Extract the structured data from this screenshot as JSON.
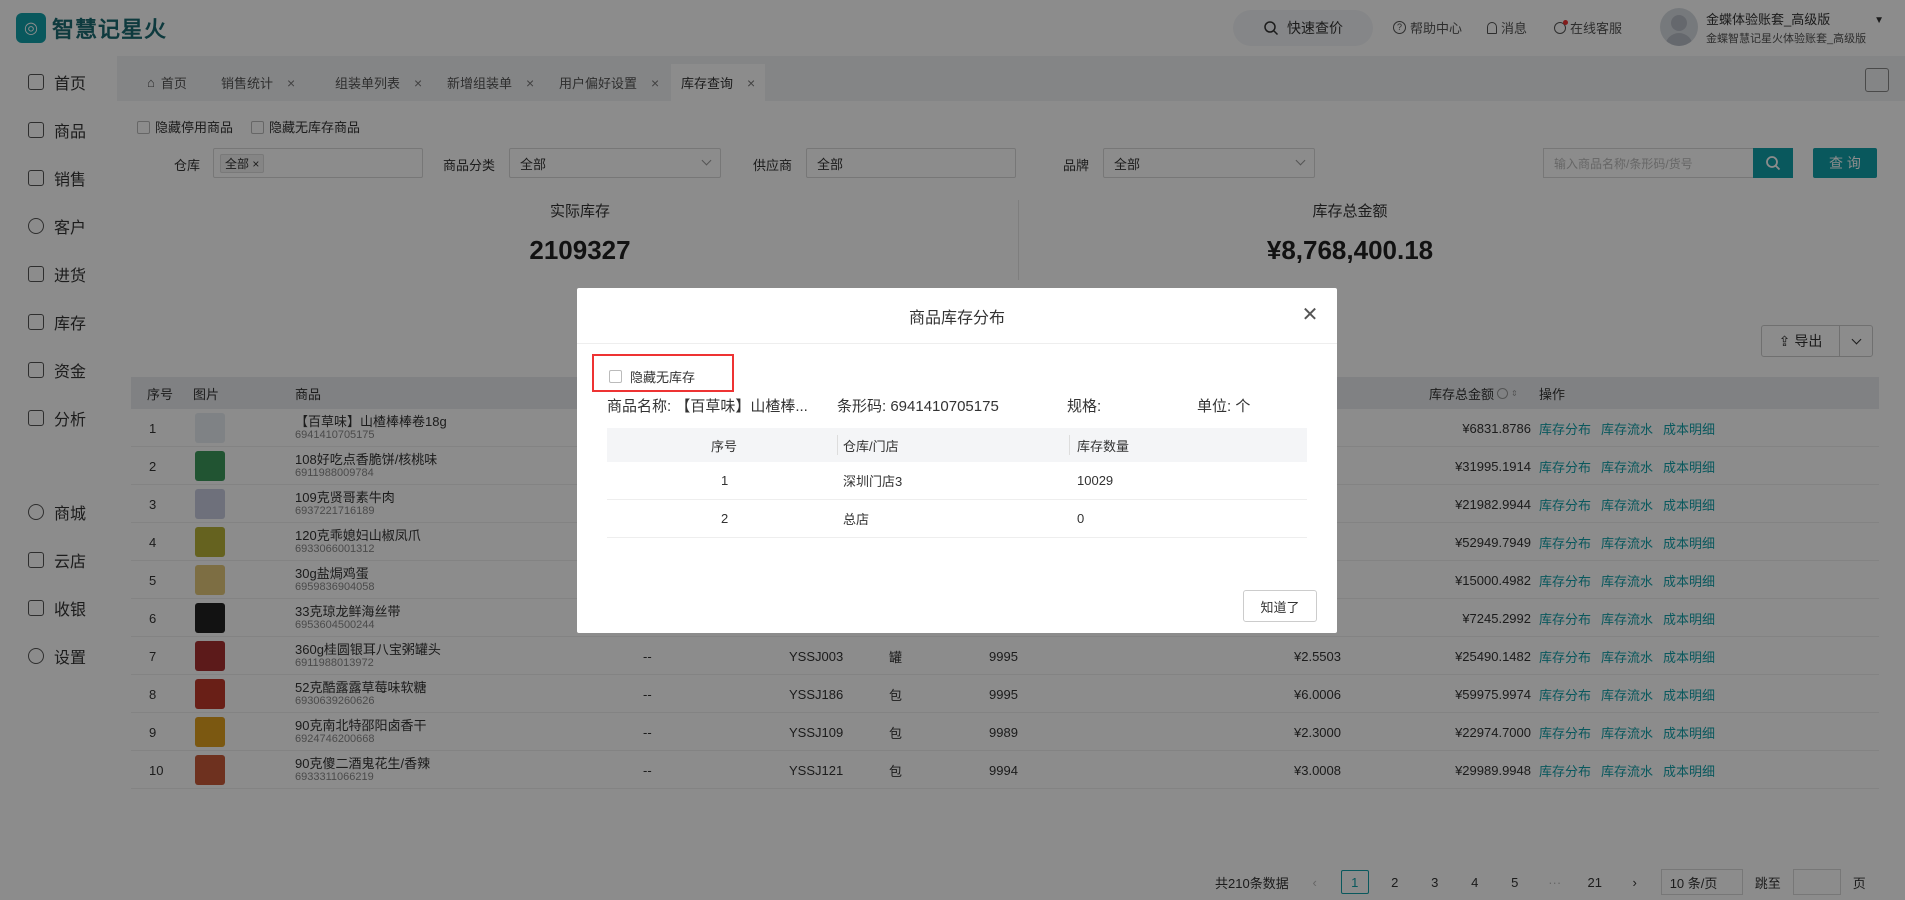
{
  "app": {
    "logo_mark": "◎",
    "title": "智慧记星火"
  },
  "header": {
    "quick_search": "快速查价",
    "help": "帮助中心",
    "messages": "消息",
    "service": "在线客服",
    "user_name": "金蝶体验账套_高级版",
    "user_org": "金蝶智慧记星火体验账套_高级版"
  },
  "sidebar": {
    "items": [
      {
        "label": "首页",
        "icon": "home-icon"
      },
      {
        "label": "商品",
        "icon": "goods-icon"
      },
      {
        "label": "销售",
        "icon": "sales-icon"
      },
      {
        "label": "客户",
        "icon": "customer-icon"
      },
      {
        "label": "进货",
        "icon": "purchase-icon"
      },
      {
        "label": "库存",
        "icon": "inventory-icon"
      },
      {
        "label": "资金",
        "icon": "funds-icon"
      },
      {
        "label": "分析",
        "icon": "analysis-icon"
      },
      {
        "label": "商城",
        "icon": "mall-icon"
      },
      {
        "label": "云店",
        "icon": "cloud-store-icon"
      },
      {
        "label": "收银",
        "icon": "cashier-icon"
      },
      {
        "label": "设置",
        "icon": "settings-icon"
      }
    ]
  },
  "tabs": [
    {
      "label": "首页",
      "closable": false
    },
    {
      "label": "销售统计",
      "closable": true
    },
    {
      "label": "组装单列表",
      "closable": true
    },
    {
      "label": "新增组装单",
      "closable": true
    },
    {
      "label": "用户偏好设置",
      "closable": true
    },
    {
      "label": "库存查询",
      "closable": true,
      "active": true
    }
  ],
  "filters": {
    "hide_disabled": "隐藏停用商品",
    "hide_no_stock": "隐藏无库存商品",
    "warehouse_label": "仓库",
    "warehouse_value": "全部",
    "category_label": "商品分类",
    "category_value": "全部",
    "supplier_label": "供应商",
    "supplier_value": "全部",
    "brand_label": "品牌",
    "brand_value": "全部",
    "search_placeholder": "输入商品名称/条形码/货号",
    "query_button": "查 询"
  },
  "stats": {
    "actual_stock_label": "实际库存",
    "actual_stock_value": "2109327",
    "total_amount_label": "库存总金额",
    "total_amount_value": "¥8,768,400.18"
  },
  "export_label": "导出",
  "table": {
    "headers": {
      "index": "序号",
      "image": "图片",
      "product": "商品",
      "total_amount": "库存总金额",
      "ops": "操作"
    },
    "ops": [
      "库存分布",
      "库存流水",
      "成本明细"
    ],
    "rows": [
      {
        "index": "1",
        "name": "【百草味】山楂棒棒卷18g",
        "code": "6941410705175",
        "sku": "",
        "unit": "",
        "qty": "",
        "price": "",
        "amount": "¥6831.8786",
        "thumb": "#e8edf2"
      },
      {
        "index": "2",
        "name": "108好吃点香脆饼/核桃味",
        "code": "6911988009784",
        "sku": "",
        "unit": "",
        "qty": "",
        "price": "",
        "amount": "¥31995.1914",
        "thumb": "#3d9a5c"
      },
      {
        "index": "3",
        "name": "109克贤哥素牛肉",
        "code": "6937221716189",
        "sku": "",
        "unit": "",
        "qty": "",
        "price": "",
        "amount": "¥21982.9944",
        "thumb": "#c8cde0"
      },
      {
        "index": "4",
        "name": "120克乖媳妇山椒凤爪",
        "code": "6933066001312",
        "sku": "",
        "unit": "",
        "qty": "",
        "price": "",
        "amount": "¥52949.7949",
        "thumb": "#b9b23a"
      },
      {
        "index": "5",
        "name": "30g盐焗鸡蛋",
        "code": "6959836904058",
        "sku": "",
        "unit": "",
        "qty": "",
        "price": "",
        "amount": "¥15000.4982",
        "thumb": "#e3c87a"
      },
      {
        "index": "6",
        "name": "33克琼龙鲜海丝带",
        "code": "6953604500244",
        "sku": "",
        "unit": "",
        "qty": "",
        "price": "",
        "amount": "¥7245.2992",
        "thumb": "#222222"
      },
      {
        "index": "7",
        "name": "360g桂圆银耳八宝粥罐头",
        "code": "6911988013972",
        "sku": "--",
        "barcode": "YSSJ003",
        "unit": "罐",
        "qty": "9995",
        "price": "¥2.5503",
        "amount": "¥25490.1482",
        "thumb": "#a83030"
      },
      {
        "index": "8",
        "name": "52克酷露露草莓味软糖",
        "code": "6930639260626",
        "sku": "--",
        "barcode": "YSSJ186",
        "unit": "包",
        "qty": "9995",
        "price": "¥6.0006",
        "amount": "¥59975.9974",
        "thumb": "#c0392b"
      },
      {
        "index": "9",
        "name": "90克南北特邵阳卤香干",
        "code": "6924746200668",
        "sku": "--",
        "barcode": "YSSJ109",
        "unit": "包",
        "qty": "9989",
        "price": "¥2.3000",
        "amount": "¥22974.7000",
        "thumb": "#e0a020"
      },
      {
        "index": "10",
        "name": "90克傻二酒鬼花生/香辣",
        "code": "6933311066219",
        "sku": "--",
        "barcode": "YSSJ121",
        "unit": "包",
        "qty": "9994",
        "price": "¥3.0008",
        "amount": "¥29989.9948",
        "thumb": "#c85a3a"
      }
    ]
  },
  "pagination": {
    "total": "共210条数据",
    "pages": [
      "1",
      "2",
      "3",
      "4",
      "5",
      "···",
      "21"
    ],
    "page_size": "10 条/页",
    "goto": "跳至",
    "page_suffix": "页"
  },
  "modal": {
    "title": "商品库存分布",
    "hide_no_stock": "隐藏无库存",
    "product_name_label": "商品名称:",
    "product_name_value": "【百草味】山楂棒...",
    "barcode_label": "条形码:",
    "barcode_value": "6941410705175",
    "spec_label": "规格:",
    "spec_value": "",
    "unit_label": "单位:",
    "unit_value": "个",
    "headers": {
      "index": "序号",
      "store": "仓库/门店",
      "qty": "库存数量"
    },
    "rows": [
      {
        "index": "1",
        "store": "深圳门店3",
        "qty": "10029"
      },
      {
        "index": "2",
        "store": "总店",
        "qty": "0"
      }
    ],
    "ok_button": "知道了"
  }
}
